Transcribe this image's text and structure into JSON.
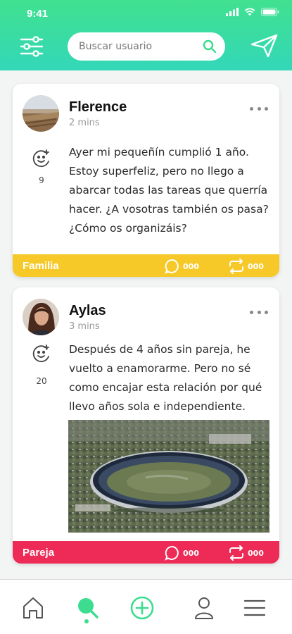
{
  "status_bar": {
    "time": "9:41"
  },
  "header": {
    "search": {
      "placeholder": "Buscar usuario",
      "value": ""
    }
  },
  "posts": [
    {
      "author": "Flerence",
      "time": "2 mins",
      "reaction_count": "9",
      "text": "Ayer mi pequeñín cumplió 1 año. Estoy superfeliz, pero no llego a abarcar todas las tareas que querría hacer. ¿A vosotras también os pasa? ¿Cómo os organizáis?",
      "category": "Familia",
      "category_color": "#f6c928",
      "comments": "000",
      "shares": "000"
    },
    {
      "author": "Aylas",
      "time": "3 mins",
      "reaction_count": "20",
      "text": "Después de 4 años sin pareja, he vuelto a enamorarme. Pero no sé como encajar esta relación por qué llevo años sola e independiente.",
      "category": "Pareja",
      "category_color": "#ee2a56",
      "comments": "000",
      "shares": "000"
    }
  ],
  "colors": {
    "accent": "#3ddc8f",
    "header_top": "#40e18f",
    "header_bottom": "#33d7b8"
  }
}
